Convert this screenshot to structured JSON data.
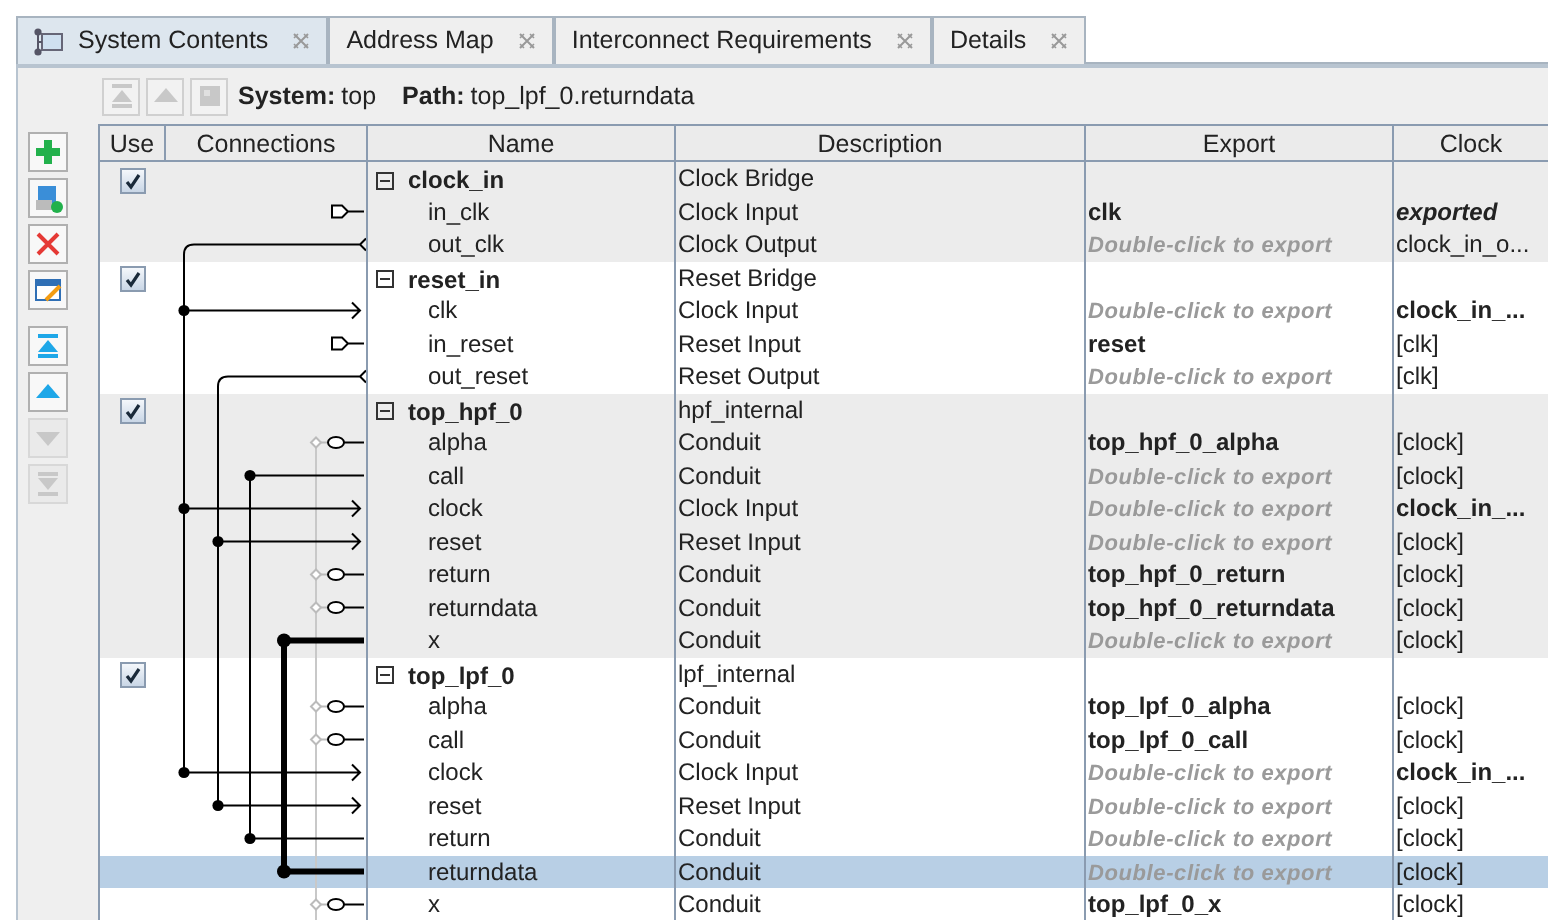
{
  "tabs": [
    {
      "label": "System Contents",
      "selected": true,
      "kind": "system"
    },
    {
      "label": "Address Map",
      "selected": false
    },
    {
      "label": "Interconnect Requirements",
      "selected": false
    },
    {
      "label": "Details",
      "selected": false
    }
  ],
  "toolbar": {
    "buttons": [
      {
        "kind": "move-top",
        "disabled": true
      },
      {
        "kind": "move-up",
        "disabled": true
      },
      {
        "kind": "system",
        "disabled": true
      }
    ],
    "system_label": "System:",
    "system": "top",
    "path_label": "Path:",
    "path": "top_lpf_0.returndata"
  },
  "side_buttons": [
    {
      "kind": "add",
      "disabled": false
    },
    {
      "kind": "add-module",
      "disabled": false
    },
    {
      "kind": "remove",
      "disabled": false
    },
    {
      "kind": "edit",
      "disabled": false
    },
    {
      "kind": "move-top",
      "disabled": false
    },
    {
      "kind": "move-up",
      "disabled": false
    },
    {
      "kind": "move-down",
      "disabled": true
    },
    {
      "kind": "move-bottom",
      "disabled": true
    }
  ],
  "table": {
    "columns": [
      "Use",
      "Connections",
      "Name",
      "Description",
      "Export",
      "Clock"
    ],
    "modules": [
      {
        "name": "clock_in",
        "description": "Clock Bridge",
        "use": true,
        "expanded": true,
        "ports": [
          {
            "name": "in_clk",
            "description": "Clock Input",
            "export": {
              "value": "clk"
            },
            "clock": "exported",
            "clock_bold": true,
            "clock_italic": true,
            "selected": false
          },
          {
            "name": "out_clk",
            "description": "Clock Output",
            "export": {
              "placeholder": "Double-click to export"
            },
            "clock": "clock_in_o...",
            "clock_bold": false,
            "clock_italic": false,
            "selected": false
          }
        ]
      },
      {
        "name": "reset_in",
        "description": "Reset Bridge",
        "use": true,
        "expanded": true,
        "ports": [
          {
            "name": "clk",
            "description": "Clock Input",
            "export": {
              "placeholder": "Double-click to export"
            },
            "clock": "clock_in_...",
            "clock_bold": true,
            "clock_italic": false,
            "selected": false
          },
          {
            "name": "in_reset",
            "description": "Reset Input",
            "export": {
              "value": "reset"
            },
            "clock": "[clk]",
            "clock_bold": false,
            "clock_italic": false,
            "selected": false
          },
          {
            "name": "out_reset",
            "description": "Reset Output",
            "export": {
              "placeholder": "Double-click to export"
            },
            "clock": "[clk]",
            "clock_bold": false,
            "clock_italic": false,
            "selected": false
          }
        ]
      },
      {
        "name": "top_hpf_0",
        "description": "hpf_internal",
        "use": true,
        "expanded": true,
        "ports": [
          {
            "name": "alpha",
            "description": "Conduit",
            "export": {
              "value": "top_hpf_0_alpha"
            },
            "clock": "[clock]",
            "clock_bold": false,
            "clock_italic": false,
            "selected": false
          },
          {
            "name": "call",
            "description": "Conduit",
            "export": {
              "placeholder": "Double-click to export"
            },
            "clock": "[clock]",
            "clock_bold": false,
            "clock_italic": false,
            "selected": false
          },
          {
            "name": "clock",
            "description": "Clock Input",
            "export": {
              "placeholder": "Double-click to export"
            },
            "clock": "clock_in_...",
            "clock_bold": true,
            "clock_italic": false,
            "selected": false
          },
          {
            "name": "reset",
            "description": "Reset Input",
            "export": {
              "placeholder": "Double-click to export"
            },
            "clock": "[clock]",
            "clock_bold": false,
            "clock_italic": false,
            "selected": false
          },
          {
            "name": "return",
            "description": "Conduit",
            "export": {
              "value": "top_hpf_0_return"
            },
            "clock": "[clock]",
            "clock_bold": false,
            "clock_italic": false,
            "selected": false
          },
          {
            "name": "returndata",
            "description": "Conduit",
            "export": {
              "value": "top_hpf_0_returndata"
            },
            "clock": "[clock]",
            "clock_bold": false,
            "clock_italic": false,
            "selected": false
          },
          {
            "name": "x",
            "description": "Conduit",
            "export": {
              "placeholder": "Double-click to export"
            },
            "clock": "[clock]",
            "clock_bold": false,
            "clock_italic": false,
            "selected": false
          }
        ]
      },
      {
        "name": "top_lpf_0",
        "description": "lpf_internal",
        "use": true,
        "expanded": true,
        "ports": [
          {
            "name": "alpha",
            "description": "Conduit",
            "export": {
              "value": "top_lpf_0_alpha"
            },
            "clock": "[clock]",
            "clock_bold": false,
            "clock_italic": false,
            "selected": false
          },
          {
            "name": "call",
            "description": "Conduit",
            "export": {
              "value": "top_lpf_0_call"
            },
            "clock": "[clock]",
            "clock_bold": false,
            "clock_italic": false,
            "selected": false
          },
          {
            "name": "clock",
            "description": "Clock Input",
            "export": {
              "placeholder": "Double-click to export"
            },
            "clock": "clock_in_...",
            "clock_bold": true,
            "clock_italic": false,
            "selected": false
          },
          {
            "name": "reset",
            "description": "Reset Input",
            "export": {
              "placeholder": "Double-click to export"
            },
            "clock": "[clock]",
            "clock_bold": false,
            "clock_italic": false,
            "selected": false
          },
          {
            "name": "return",
            "description": "Conduit",
            "export": {
              "placeholder": "Double-click to export"
            },
            "clock": "[clock]",
            "clock_bold": false,
            "clock_italic": false,
            "selected": false
          },
          {
            "name": "returndata",
            "description": "Conduit",
            "export": {
              "placeholder": "Double-click to export"
            },
            "clock": "[clock]",
            "clock_bold": false,
            "clock_italic": false,
            "selected": true
          },
          {
            "name": "x",
            "description": "Conduit",
            "export": {
              "value": "top_lpf_0_x"
            },
            "clock": "[clock]",
            "clock_bold": false,
            "clock_italic": false,
            "selected": false
          }
        ]
      }
    ]
  }
}
